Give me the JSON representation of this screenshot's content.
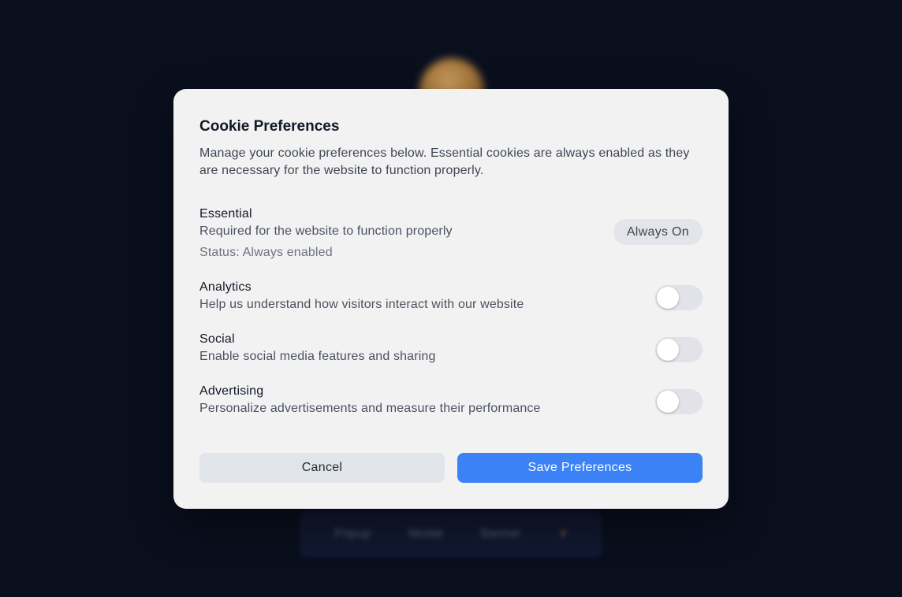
{
  "background": {
    "nav_items": [
      "Popup",
      "Modal",
      "Banner"
    ],
    "nav_icon": "lightning-icon"
  },
  "modal": {
    "title": "Cookie Preferences",
    "description": "Manage your cookie preferences below. Essential cookies are always enabled as they are necessary for the website to function properly."
  },
  "categories": {
    "essential": {
      "name": "Essential",
      "description": "Required for the website to function properly",
      "status": "Status: Always enabled",
      "badge": "Always On"
    },
    "analytics": {
      "name": "Analytics",
      "description": "Help us understand how visitors interact with our website",
      "enabled": false
    },
    "social": {
      "name": "Social",
      "description": "Enable social media features and sharing",
      "enabled": false
    },
    "advertising": {
      "name": "Advertising",
      "description": "Personalize advertisements and measure their performance",
      "enabled": false
    }
  },
  "actions": {
    "cancel_label": "Cancel",
    "save_label": "Save Preferences"
  },
  "colors": {
    "primary": "#3b82f6",
    "modal_bg": "#f2f2f2",
    "page_bg": "#0a0f1e",
    "toggle_off": "#e1e3e8"
  }
}
